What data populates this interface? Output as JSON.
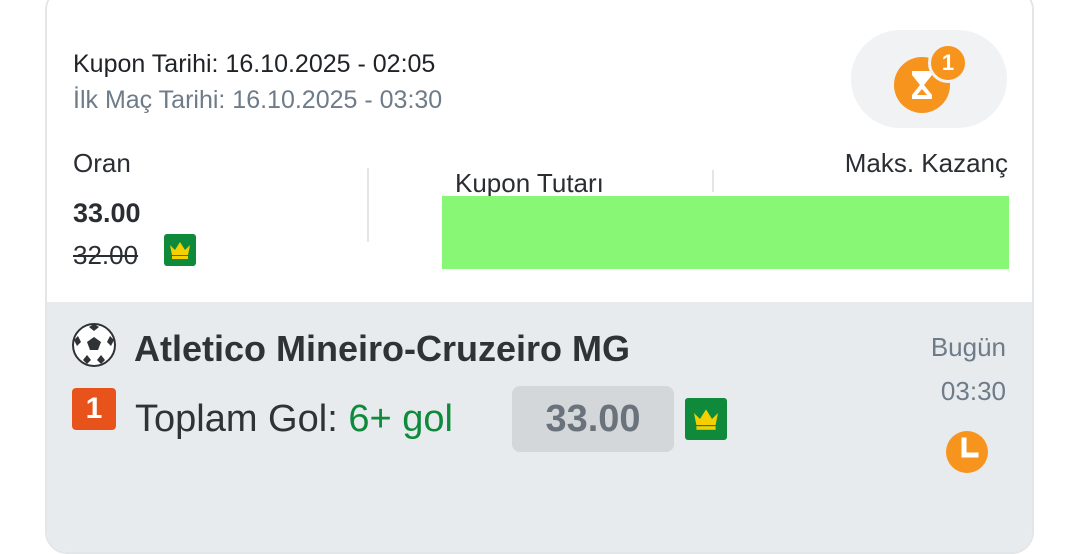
{
  "coupon": {
    "coupon_date": "Kupon Tarihi: 16.10.2025 - 02:05",
    "first_match_date": "İlk Maç Tarihi: 16.10.2025 - 03:30",
    "pending_count": "1",
    "odds_label": "Oran",
    "stake_label": "Kupon Tutarı",
    "max_win_label": "Maks. Kazanç",
    "odds_new": "33.00",
    "odds_old": "32.00"
  },
  "match": {
    "title": "Atletico Mineiro-Cruzeiro MG",
    "index": "1",
    "market_label": "Toplam Gol:",
    "selection": "6+ gol",
    "odds": "33.00",
    "day": "Bugün",
    "time": "03:30"
  },
  "colors": {
    "accent_orange": "#f7941d",
    "green": "#0f8a3b",
    "redaction": "#88f775",
    "badge_red": "#e8531b"
  },
  "icons": [
    "hourglass-icon",
    "crown-icon",
    "soccer-ball-icon",
    "clock-icon"
  ]
}
